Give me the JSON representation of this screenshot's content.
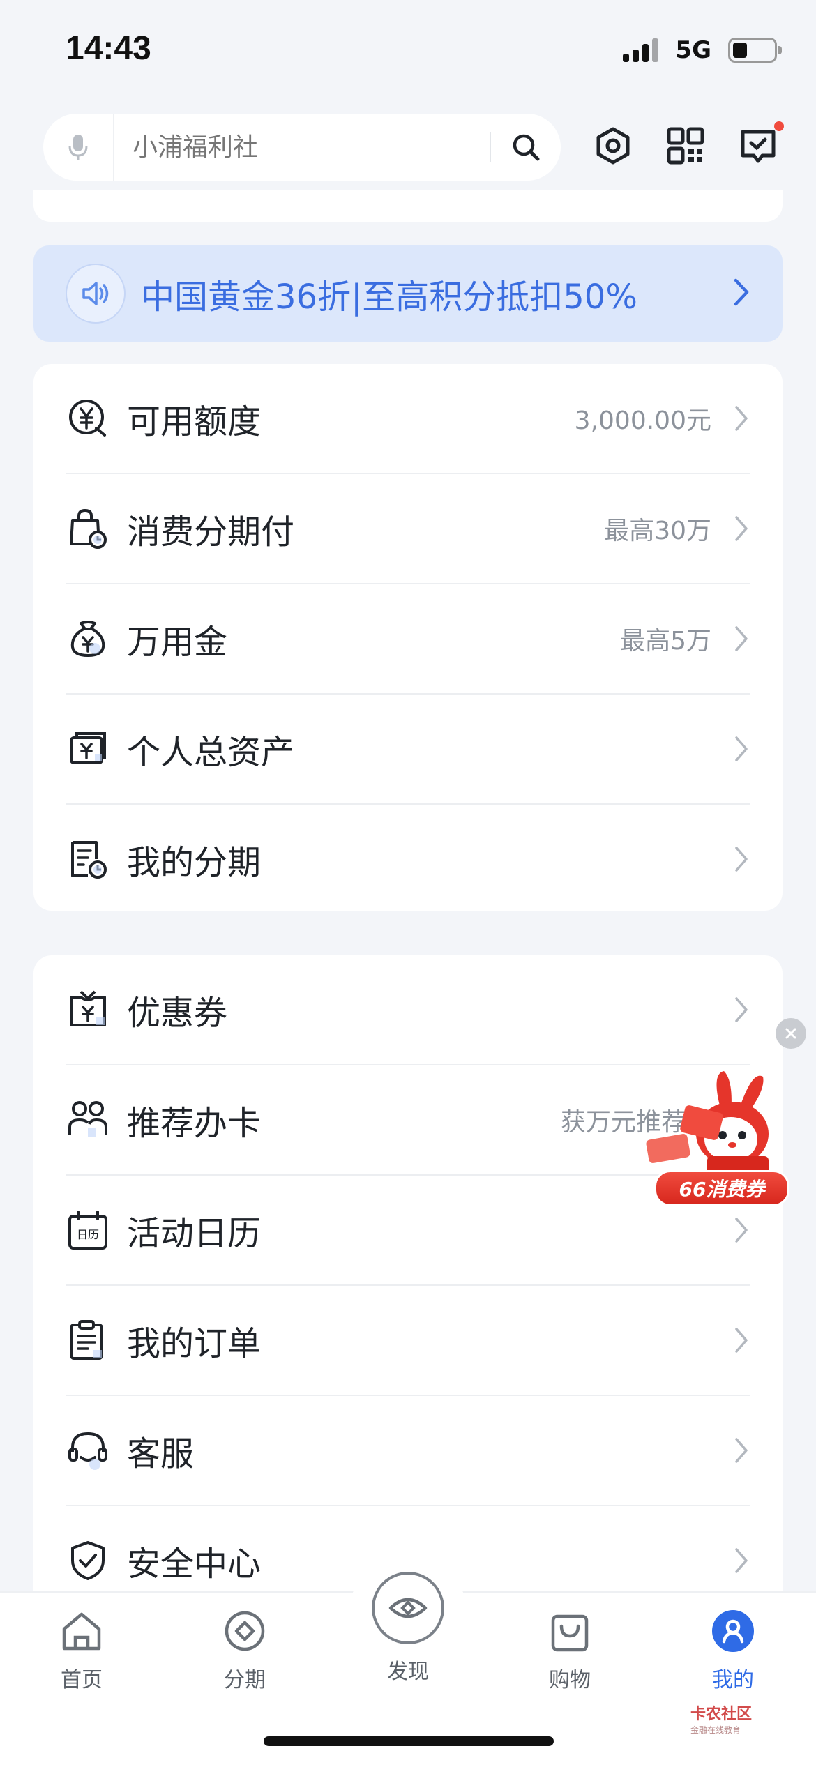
{
  "status_bar": {
    "time": "14:43",
    "network": "5G"
  },
  "search": {
    "placeholder": "小浦福利社"
  },
  "banner": {
    "text": "中国黄金36折|至高积分抵扣50%"
  },
  "card1": {
    "rows": [
      {
        "label": "可用额度",
        "value": "3,000.00元",
        "icon": "yen-circle-icon"
      },
      {
        "label": "消费分期付",
        "value": "最高30万",
        "icon": "shopping-bag-clock-icon"
      },
      {
        "label": "万用金",
        "value": "最高5万",
        "icon": "money-bag-icon"
      },
      {
        "label": "个人总资产",
        "value": "",
        "icon": "wallet-icon"
      },
      {
        "label": "我的分期",
        "value": "",
        "icon": "bill-clock-icon"
      }
    ]
  },
  "card2": {
    "rows": [
      {
        "label": "优惠券",
        "value": "",
        "icon": "coupon-icon"
      },
      {
        "label": "推荐办卡",
        "value": "获万元推荐礼",
        "icon": "people-icon"
      },
      {
        "label": "活动日历",
        "value": "",
        "icon": "calendar-icon",
        "icon_text": "日历"
      },
      {
        "label": "我的订单",
        "value": "",
        "icon": "order-clipboard-icon"
      },
      {
        "label": "客服",
        "value": "",
        "icon": "headset-icon"
      },
      {
        "label": "安全中心",
        "value": "",
        "icon": "shield-check-icon"
      }
    ]
  },
  "promo": {
    "label": "66消费券"
  },
  "tab_bar": {
    "tabs": [
      {
        "label": "首页",
        "icon": "home-icon"
      },
      {
        "label": "分期",
        "icon": "installment-icon"
      },
      {
        "label": "发现",
        "icon": "eye-icon"
      },
      {
        "label": "购物",
        "icon": "shopping-bag-icon"
      },
      {
        "label": "我的",
        "icon": "user-icon"
      }
    ],
    "active": "我的"
  },
  "watermark": {
    "title": "卡农社区",
    "subtitle": "金融在线教育"
  },
  "colors": {
    "accent": "#2F6BE6",
    "banner_bg": "#DCE7FB",
    "banner_text": "#3A6DE0",
    "page_bg": "#F3F5F9",
    "promo_red": "#E5352B"
  }
}
